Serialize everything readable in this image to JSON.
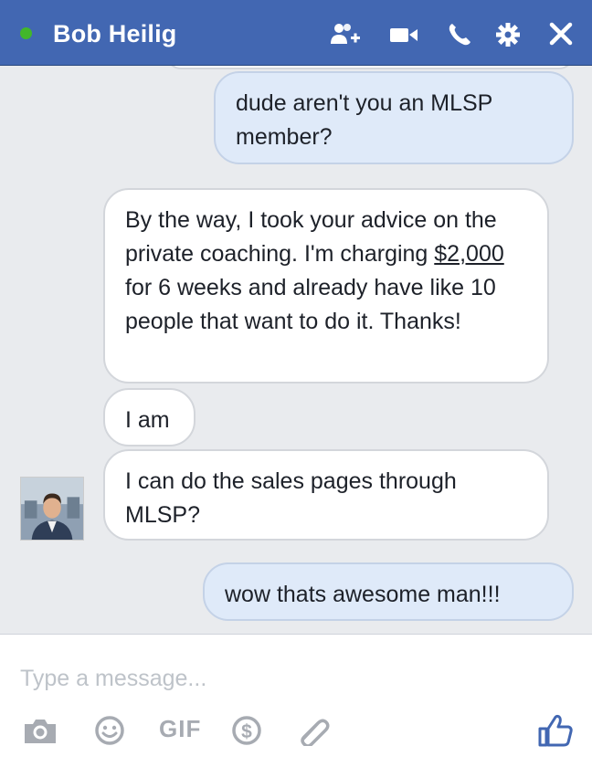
{
  "header": {
    "contact_name": "Bob Heilig",
    "status": "online",
    "status_color": "#42b72a",
    "bar_color": "#4267b2",
    "icons": [
      "add-people-icon",
      "video-call-icon",
      "phone-call-icon",
      "settings-gear-icon",
      "close-icon"
    ]
  },
  "conversation": {
    "messages": [
      {
        "direction": "outgoing",
        "text": "dude aren't you an MLSP member?"
      },
      {
        "direction": "incoming",
        "text_before": "By the way, I took your advice on the private coaching.  I'm charging ",
        "text_link": "$2,000",
        "text_after": " for 6 weeks and already have like 10 people that want to do it.  Thanks!"
      },
      {
        "direction": "incoming",
        "text": "I am"
      },
      {
        "direction": "incoming",
        "text": "I can do the sales pages through MLSP?"
      },
      {
        "direction": "outgoing",
        "text": "wow thats awesome man!!!"
      }
    ]
  },
  "composer": {
    "placeholder": "Type a message...",
    "value": "",
    "gif_label": "GIF",
    "tools": [
      "camera-icon",
      "emoji-icon",
      "gif-button",
      "payment-icon",
      "attachment-icon",
      "like-thumb-icon"
    ],
    "like_color": "#4267b2"
  }
}
